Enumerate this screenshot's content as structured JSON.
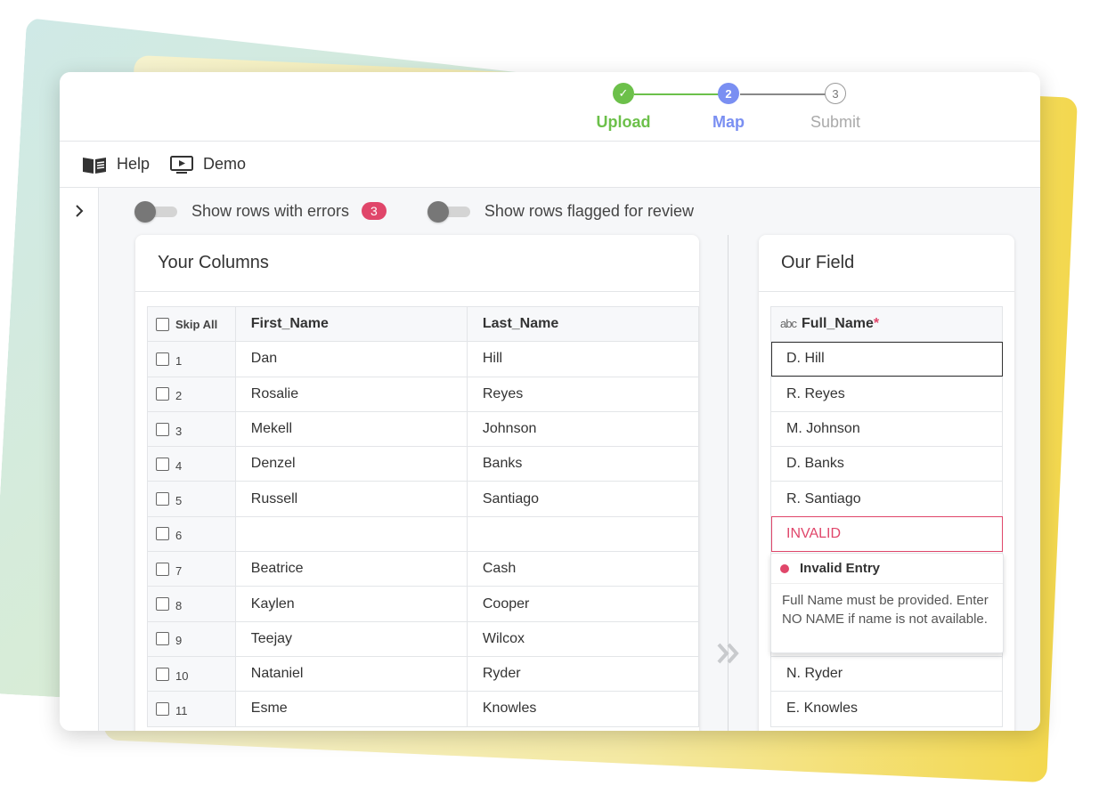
{
  "stepper": {
    "steps": [
      {
        "label": "Upload",
        "marker": "✓",
        "state": "done"
      },
      {
        "label": "Map",
        "marker": "2",
        "state": "active"
      },
      {
        "label": "Submit",
        "marker": "3",
        "state": "pending"
      }
    ]
  },
  "toolbar": {
    "help_label": "Help",
    "demo_label": "Demo"
  },
  "filters": {
    "errors_label": "Show rows with errors",
    "errors_count": "3",
    "flagged_label": "Show rows flagged for review"
  },
  "left_panel": {
    "title": "Your Columns",
    "skip_all_label": "Skip All",
    "columns": [
      "First_Name",
      "Last_Name"
    ],
    "rows": [
      {
        "num": "1",
        "first": "Dan",
        "last": "Hill"
      },
      {
        "num": "2",
        "first": "Rosalie",
        "last": "Reyes"
      },
      {
        "num": "3",
        "first": "Mekell",
        "last": "Johnson"
      },
      {
        "num": "4",
        "first": "Denzel",
        "last": "Banks"
      },
      {
        "num": "5",
        "first": "Russell",
        "last": "Santiago"
      },
      {
        "num": "6",
        "first": "",
        "last": ""
      },
      {
        "num": "7",
        "first": "Beatrice",
        "last": "Cash"
      },
      {
        "num": "8",
        "first": "Kaylen",
        "last": "Cooper"
      },
      {
        "num": "9",
        "first": "Teejay",
        "last": "Wilcox"
      },
      {
        "num": "10",
        "first": "Nataniel",
        "last": "Ryder"
      },
      {
        "num": "11",
        "first": "Esme",
        "last": "Knowles"
      }
    ]
  },
  "right_panel": {
    "title": "Our Field",
    "type_icon": "abc",
    "field_name": "Full_Name",
    "required_mark": "*",
    "values": [
      "D. Hill",
      "R. Reyes",
      "M. Johnson",
      "D. Banks",
      "R. Santiago",
      "INVALID",
      "",
      "",
      "",
      "N. Ryder",
      "E. Knowles"
    ]
  },
  "tooltip": {
    "title": "Invalid Entry",
    "message": "Full Name must be provided. Enter NO NAME if name is not available."
  },
  "colors": {
    "success": "#6cc04a",
    "active": "#7a8ff2",
    "error": "#e0466a"
  }
}
